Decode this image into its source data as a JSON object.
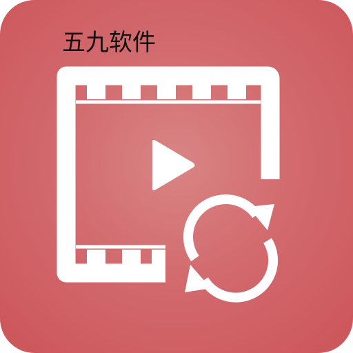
{
  "icon": {
    "brand_label": "五九软件",
    "background_color": "#cf5f63",
    "glyph_color": "#ffffff",
    "glyphs": [
      "film-strip-icon",
      "play-icon",
      "refresh-icon"
    ]
  }
}
